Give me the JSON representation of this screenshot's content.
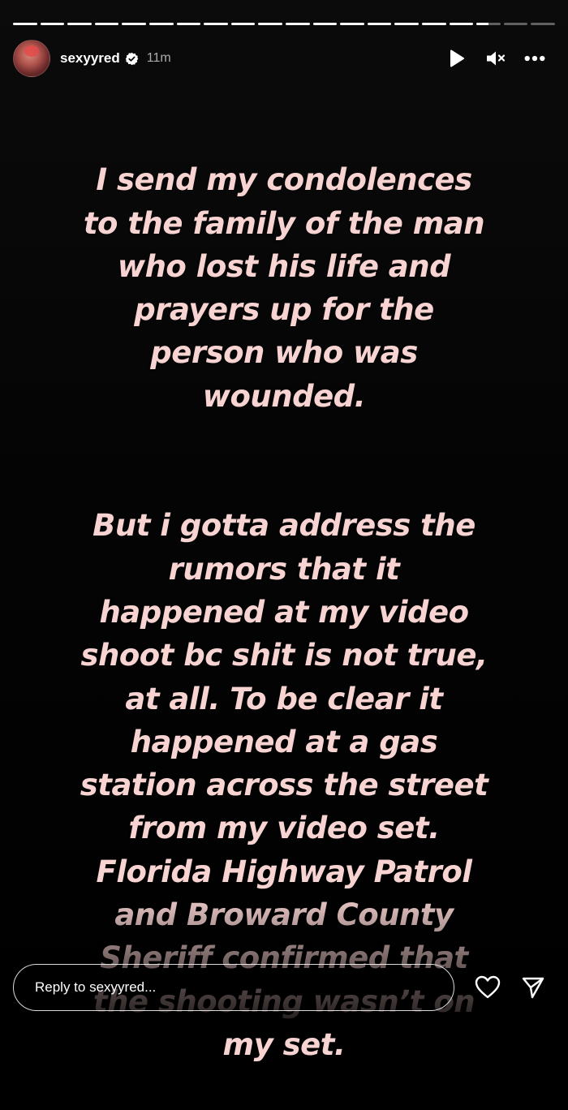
{
  "story": {
    "progress": {
      "segment_count": 20,
      "completed_segments": 17,
      "current_segment_progress": 0.5
    },
    "header": {
      "username": "sexyyred",
      "verified": true,
      "time_ago": "11m",
      "icons": {
        "avatar": "profile-avatar",
        "verified": "verified-badge-icon",
        "play": "play-icon",
        "mute": "speaker-muted-icon",
        "more": "more-options-icon"
      }
    },
    "caption": {
      "paragraph_1": "I send my condolences\nto the family of the man\nwho lost his life and\nprayers up for the\nperson who was\nwounded.",
      "paragraph_2": "But i gotta address the\nrumors that it\nhappened at my video\nshoot bc shit is not true,\nat all.  To be clear it\nhappened at a gas\nstation across the street\nfrom my video set.\nFlorida Highway Patrol\nand Broward County\nSheriff confirmed that\nthe shooting wasn’t on\nmy set.",
      "text_color": "#f7d3d1"
    },
    "reply": {
      "placeholder": "Reply to sexyyred...",
      "icons": {
        "like": "heart-icon",
        "share": "send-icon"
      }
    }
  }
}
